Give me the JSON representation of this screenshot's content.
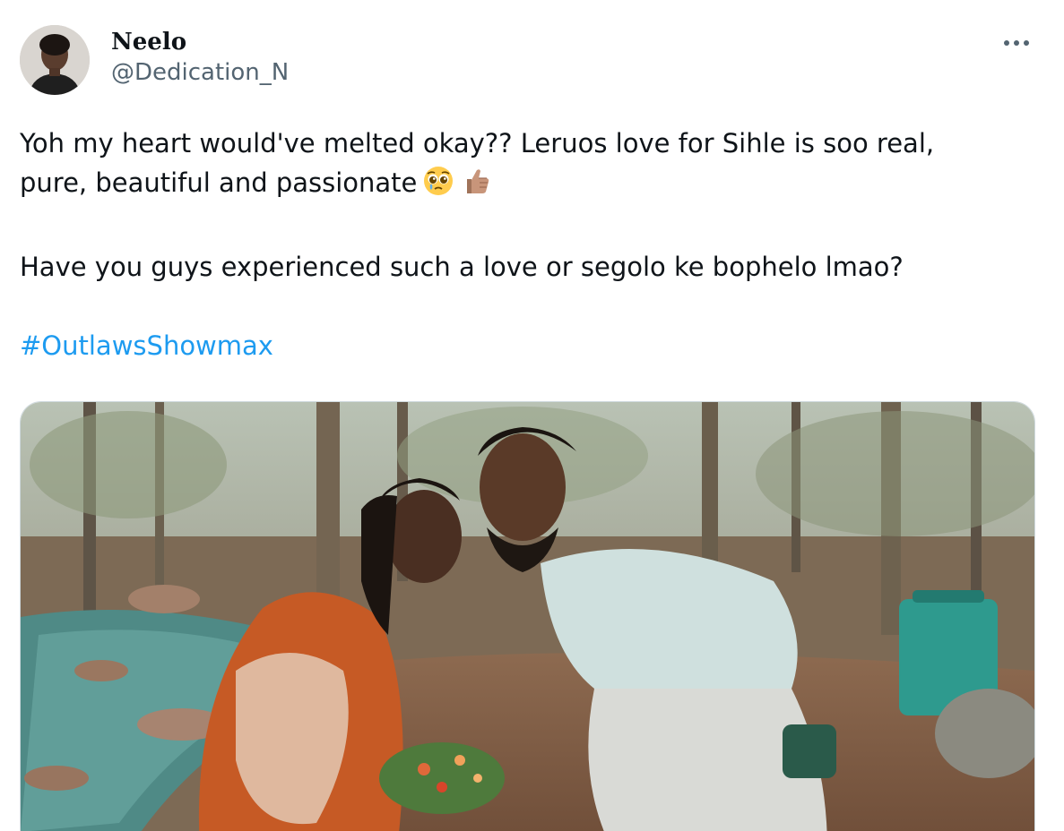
{
  "tweet": {
    "author": {
      "display_name": "Neelo",
      "handle": "@Dedication_N"
    },
    "text_line1": "Yoh my heart would've melted okay?? Leruos love for Sihle is soo real,",
    "text_line2": "pure, beautiful and passionate",
    "text_line3": "Have you guys experienced such a love or segolo ke bophelo lmao?",
    "hashtag": "#OutlawsShowmax",
    "emojis": [
      "pleading-face-emoji",
      "thumbs-up-emoji"
    ],
    "more_icon": "more-horizontal-icon",
    "media": {
      "type": "photo",
      "alt_description_shown": ""
    },
    "colors": {
      "text": "#0f1419",
      "secondary": "#536471",
      "link": "#1d9bf0",
      "border": "#cfd9de"
    }
  }
}
